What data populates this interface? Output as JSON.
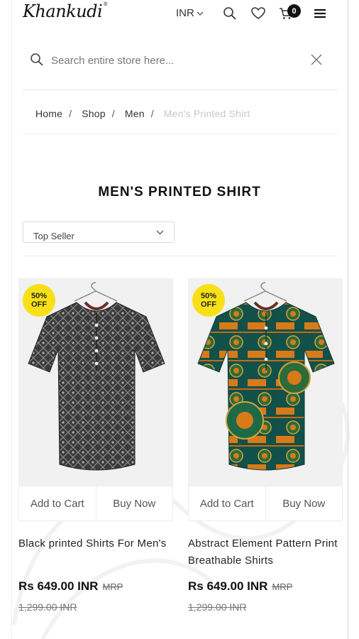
{
  "header": {
    "logo_text": "Khankudi",
    "logo_mark": "®",
    "currency": "INR",
    "cart_count": "0",
    "icons": [
      "chevron-down-icon",
      "search-icon",
      "heart-icon",
      "cart-icon",
      "menu-icon"
    ]
  },
  "search": {
    "placeholder": "Search entire store here...",
    "value": ""
  },
  "breadcrumb": [
    {
      "label": "Home"
    },
    {
      "label": "Shop"
    },
    {
      "label": "Men"
    },
    {
      "label": "Men's Printed Shirt"
    }
  ],
  "page_title": "MEN'S PRINTED SHIRT",
  "sort": {
    "selected": "Top Seller"
  },
  "products": [
    {
      "badge_line1": "50%",
      "badge_line2": "OFF",
      "name": "Black printed Shirts For Men's",
      "price": "Rs 649.00 INR",
      "mrp_label": "MRP",
      "old_price": "1,299.00 INR",
      "add_to_cart": "Add to Cart",
      "buy_now": "Buy Now"
    },
    {
      "badge_line1": "50%",
      "badge_line2": "OFF",
      "name": "Abstract Element Pattern Print Breathable Shirts",
      "price": "Rs 649.00 INR",
      "mrp_label": "MRP",
      "old_price": "1,299.00 INR",
      "add_to_cart": "Add to Cart",
      "buy_now": "Buy Now"
    }
  ],
  "colors": {
    "badge": "#f7e116",
    "text": "#222222",
    "breadcrumb_current": "#c8c8c8"
  }
}
